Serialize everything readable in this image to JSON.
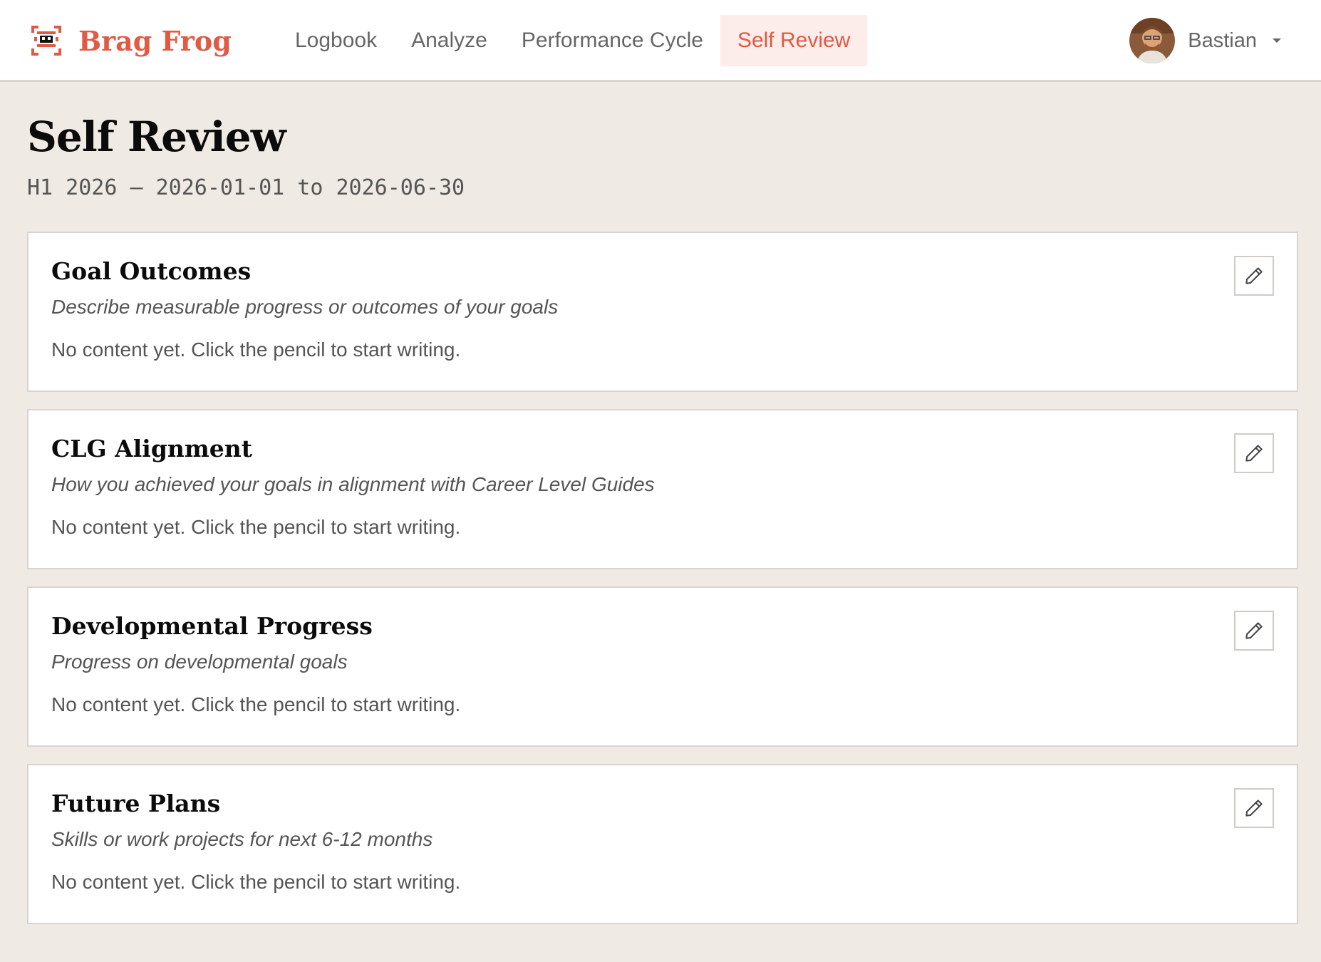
{
  "brand": {
    "name": "Brag Frog",
    "accent_color": "#e05a44",
    "logo_icon": "frog-logo-icon"
  },
  "nav": {
    "items": [
      {
        "label": "Logbook",
        "active": false
      },
      {
        "label": "Analyze",
        "active": false
      },
      {
        "label": "Performance Cycle",
        "active": false
      },
      {
        "label": "Self Review",
        "active": true
      }
    ]
  },
  "user": {
    "name": "Bastian",
    "avatar_icon": "user-avatar",
    "menu_icon": "caret-down-icon"
  },
  "page": {
    "title": "Self Review",
    "period": "H1 2026 — 2026-01-01 to 2026-06-30"
  },
  "sections": [
    {
      "title": "Goal Outcomes",
      "description": "Describe measurable progress or outcomes of your goals",
      "empty_text": "No content yet. Click the pencil to start writing.",
      "edit_icon": "pencil-icon"
    },
    {
      "title": "CLG Alignment",
      "description": "How you achieved your goals in alignment with Career Level Guides",
      "empty_text": "No content yet. Click the pencil to start writing.",
      "edit_icon": "pencil-icon"
    },
    {
      "title": "Developmental Progress",
      "description": "Progress on developmental goals",
      "empty_text": "No content yet. Click the pencil to start writing.",
      "edit_icon": "pencil-icon"
    },
    {
      "title": "Future Plans",
      "description": "Skills or work projects for next 6-12 months",
      "empty_text": "No content yet. Click the pencil to start writing.",
      "edit_icon": "pencil-icon"
    }
  ]
}
